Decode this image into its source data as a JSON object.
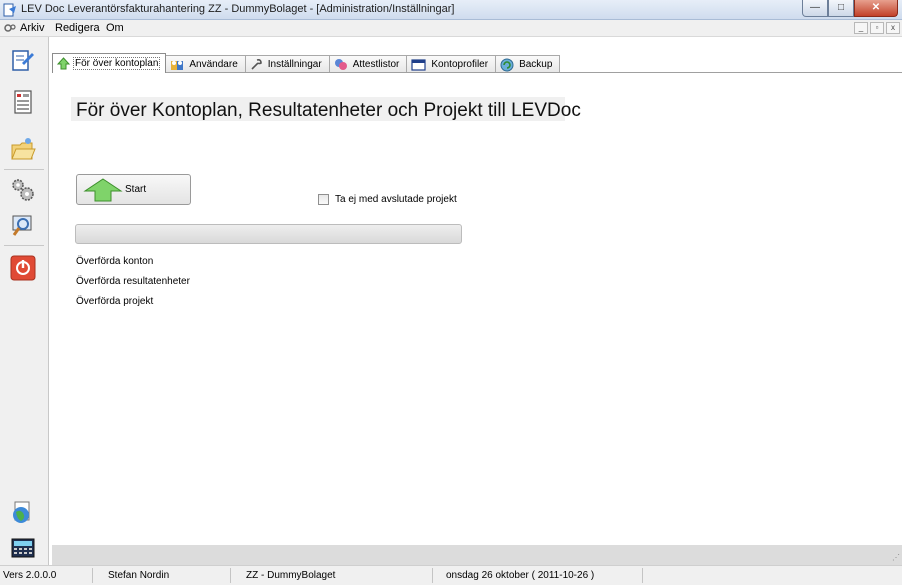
{
  "window": {
    "title": "LEV Doc  Leverantörsfakturahantering  ZZ - DummyBolaget - [Administration/Inställningar]",
    "minimize_label": "—",
    "maximize_label": "□",
    "close_label": "✕"
  },
  "menu": {
    "items": [
      "Arkiv",
      "Redigera",
      "Om"
    ],
    "mdi_minimize": "_",
    "mdi_restore": "▫",
    "mdi_close": "x"
  },
  "sidebar": {
    "icons": [
      "document-edit-icon",
      "form-list-icon",
      "folder-open-icon",
      "gears-icon",
      "search-window-icon",
      "power-icon",
      "globe-icon",
      "calculator-icon"
    ]
  },
  "tabs": [
    {
      "label": "För över kontoplan",
      "icon": "home-arrow-icon",
      "active": true
    },
    {
      "label": "Användare",
      "icon": "users-icon",
      "active": false
    },
    {
      "label": "Inställningar",
      "icon": "wrench-icon",
      "active": false
    },
    {
      "label": "Attestlistor",
      "icon": "attest-icon",
      "active": false
    },
    {
      "label": "Kontoprofiler",
      "icon": "table-icon",
      "active": false
    },
    {
      "label": "Backup",
      "icon": "backup-icon",
      "active": false
    }
  ],
  "content": {
    "heading": "För över Kontoplan, Resultatenheter och Projekt till LEVDoc",
    "start_button": "Start",
    "checkbox_label": "Ta ej med avslutade projekt",
    "checkbox_checked": false,
    "progress_fraction": 0,
    "stats": [
      "Överförda konton",
      "Överförda resultatenheter",
      "Överförda projekt"
    ]
  },
  "statusbar": {
    "version": "Vers 2.0.0.0",
    "user": "Stefan Nordin",
    "company": "ZZ - DummyBolaget",
    "date": "onsdag 26 oktober ( 2011-10-26 )"
  },
  "colors": {
    "accent_green": "#6cbf3d",
    "close_red": "#c2412a"
  }
}
